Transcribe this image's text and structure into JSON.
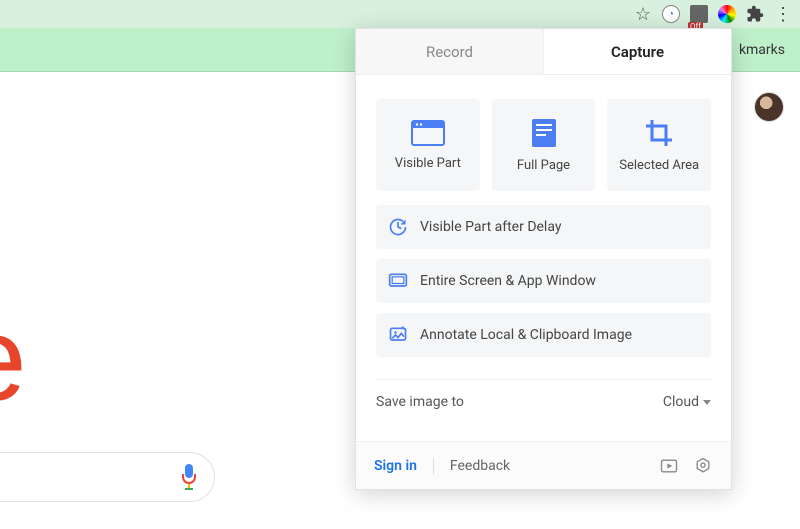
{
  "bookmarks_bar_text": "kmarks",
  "background_letter": "e",
  "popup": {
    "tabs": {
      "record": "Record",
      "capture": "Capture"
    },
    "cards": {
      "visible_part": "Visible Part",
      "full_page": "Full Page",
      "selected_area": "Selected Area"
    },
    "rows": {
      "delay": "Visible Part after Delay",
      "screen": "Entire Screen & App Window",
      "annotate": "Annotate Local & Clipboard Image"
    },
    "save_label": "Save image to",
    "save_dest": "Cloud",
    "footer": {
      "signin": "Sign in",
      "feedback": "Feedback"
    }
  },
  "ext_badge": "Off"
}
